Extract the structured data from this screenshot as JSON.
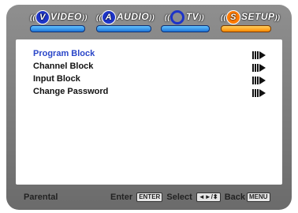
{
  "tabs": [
    {
      "label": "VIDEO",
      "badge": "V",
      "active": false
    },
    {
      "label": "AUDIO",
      "badge": "A",
      "active": false
    },
    {
      "label": "TV",
      "badge": "",
      "active": false
    },
    {
      "label": "SETUP",
      "badge": "S",
      "active": true
    }
  ],
  "menu": {
    "items": [
      {
        "label": "Program Block",
        "selected": true,
        "icon": "arrow-right-icon"
      },
      {
        "label": "Channel Block",
        "selected": false,
        "icon": "arrow-right-icon"
      },
      {
        "label": "Input Block",
        "selected": false,
        "icon": "arrow-right-icon"
      },
      {
        "label": "Change Password",
        "selected": false,
        "icon": "arrow-right-icon"
      }
    ]
  },
  "footer": {
    "title": "Parental",
    "enter_label": "Enter",
    "enter_key": "ENTER",
    "select_label": "Select",
    "select_key": "◄►/⬍",
    "back_label": "Back",
    "back_key": "MENU"
  },
  "colors": {
    "frame": "#7d7d7d",
    "tab_bar": "#1e74d8",
    "tab_active": "#ff8a00",
    "selected_text": "#2a46c8"
  }
}
